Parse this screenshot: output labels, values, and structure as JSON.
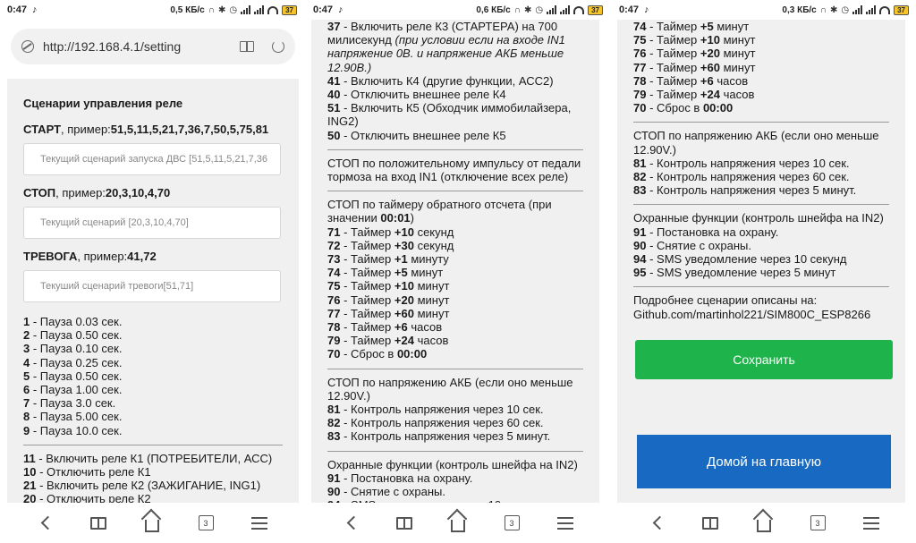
{
  "panels": [
    {
      "time": "0:47",
      "speed": "0,5 КБ/с",
      "battery": "37"
    },
    {
      "time": "0:47",
      "speed": "0,6 КБ/с",
      "battery": "37"
    },
    {
      "time": "0:47",
      "speed": "0,3 КБ/с",
      "battery": "37"
    }
  ],
  "url": "http://192.168.4.1/setting",
  "tabs_count": "3",
  "page": {
    "heading": "Сценарии управления реле",
    "start": {
      "label": "СТАРТ",
      "example_prefix": ", пример:",
      "example": "51,5,11,5,21,7,36,7,50,5,75,81",
      "placeholder": "Текущий сценарий запуска ДВС [51,5,11,5,21,7,36"
    },
    "stop": {
      "label": "СТОП",
      "example_prefix": ", пример:",
      "example": "20,3,10,4,70",
      "placeholder": "Текущий сценарий [20,3,10,4,70]"
    },
    "alarm": {
      "label": "ТРЕВОГА",
      "example_prefix": ", пример:",
      "example": "41,72",
      "placeholder": "Текуший сценарий тревоги[51,71]"
    },
    "pauses": [
      {
        "code": "1",
        "text": " - Пауза 0.03 сек."
      },
      {
        "code": "2",
        "text": " - Пауза 0.50 сек."
      },
      {
        "code": "3",
        "text": " - Пауза 0.10 сек."
      },
      {
        "code": "4",
        "text": " - Пауза 0.25 сек."
      },
      {
        "code": "5",
        "text": " - Пауза 0.50 сек."
      },
      {
        "code": "6",
        "text": " - Пауза 1.00 сек."
      },
      {
        "code": "7",
        "text": " - Пауза 3.0 сек."
      },
      {
        "code": "8",
        "text": " - Пауза 5.00 сек."
      },
      {
        "code": "9",
        "text": " - Пауза 10.0 сек."
      }
    ],
    "relays": [
      {
        "code": "11",
        "text": " - Включить реле К1 (ПОТРЕБИТЕЛИ, АСС)"
      },
      {
        "code": "10",
        "text": " - Отключить реле К1"
      },
      {
        "code": "21",
        "text": " - Включить реле К2 (ЗАЖИГАНИЕ, ING1)"
      },
      {
        "code": "20",
        "text": " - Отключить реле К2"
      },
      {
        "code": "37",
        "text": " - Включить реле К3 (СТАРТЕРА) на 700"
      }
    ],
    "relay37_cont": "милисекунд",
    "relay37_note": "(при условии если на входе IN1 напряжение 0В. и напряжение АКБ меньше 12.90В.)",
    "relays2": [
      {
        "code": "41",
        "text": " - Включить К4 (другие функции, АСС2)"
      },
      {
        "code": "40",
        "text": " - Отключить внешнее реле К4"
      },
      {
        "code": "51",
        "text": " - Включить К5 (Обходчик иммобилайзера,"
      }
    ],
    "relay51_cont": "ING2)",
    "relay50": {
      "code": "50",
      "text": " - Отключить внешнее реле К5"
    },
    "stop_pedal": "СТОП по положительному импульсу от педали тормоза на вход IN1 (отключение всех реле)",
    "stop_timer_title": "СТОП по таймеру обратного отсчета (при значении ",
    "stop_timer_value": "00:01",
    "stop_timer_close": ")",
    "timers": [
      {
        "code": "71",
        "pre": " - Таймер ",
        "val": "+10",
        "post": " секунд"
      },
      {
        "code": "72",
        "pre": " - Таймер ",
        "val": "+30",
        "post": " секунд"
      },
      {
        "code": "73",
        "pre": " - Таймер ",
        "val": "+1",
        "post": " минуту"
      },
      {
        "code": "74",
        "pre": " - Таймер ",
        "val": "+5",
        "post": " минут"
      },
      {
        "code": "75",
        "pre": " - Таймер ",
        "val": "+10",
        "post": " минут"
      },
      {
        "code": "76",
        "pre": " - Таймер ",
        "val": "+20",
        "post": " минут"
      },
      {
        "code": "77",
        "pre": " - Таймер ",
        "val": "+60",
        "post": " минут"
      },
      {
        "code": "78",
        "pre": " - Таймер ",
        "val": "+6",
        "post": " часов"
      },
      {
        "code": "79",
        "pre": " - Таймер ",
        "val": "+24",
        "post": " часов"
      }
    ],
    "reset": {
      "code": "70",
      "pre": " - Сброс в ",
      "val": "00:00"
    },
    "stop_voltage": "СТОП по напряжению АКБ (если оно меньше 12.90V.)",
    "voltage": [
      {
        "code": "81",
        "text": " - Контроль напряжения через 10 сек."
      },
      {
        "code": "82",
        "text": " - Контроль напряжения через 60 сек."
      },
      {
        "code": "83",
        "text": " - Контроль напряжения через 5 минут."
      }
    ],
    "guard_title": "Охранные функции (контроль шнейфа на IN2)",
    "guard": [
      {
        "code": "91",
        "text": " - Постановка на охрану."
      },
      {
        "code": "90",
        "text": " - Снятие с охраны."
      },
      {
        "code": "94",
        "text": " - SMS уведомление через 10 секунд"
      },
      {
        "code": "95",
        "text": " - SMS уведомление через 5 минут"
      }
    ],
    "more_title": "Подробнее сценарии описаны на:",
    "more_link": "Github.com/martinhol221/SIM800C_ESP8266",
    "save_label": "Сохранить",
    "home_label": "Домой на главную"
  }
}
